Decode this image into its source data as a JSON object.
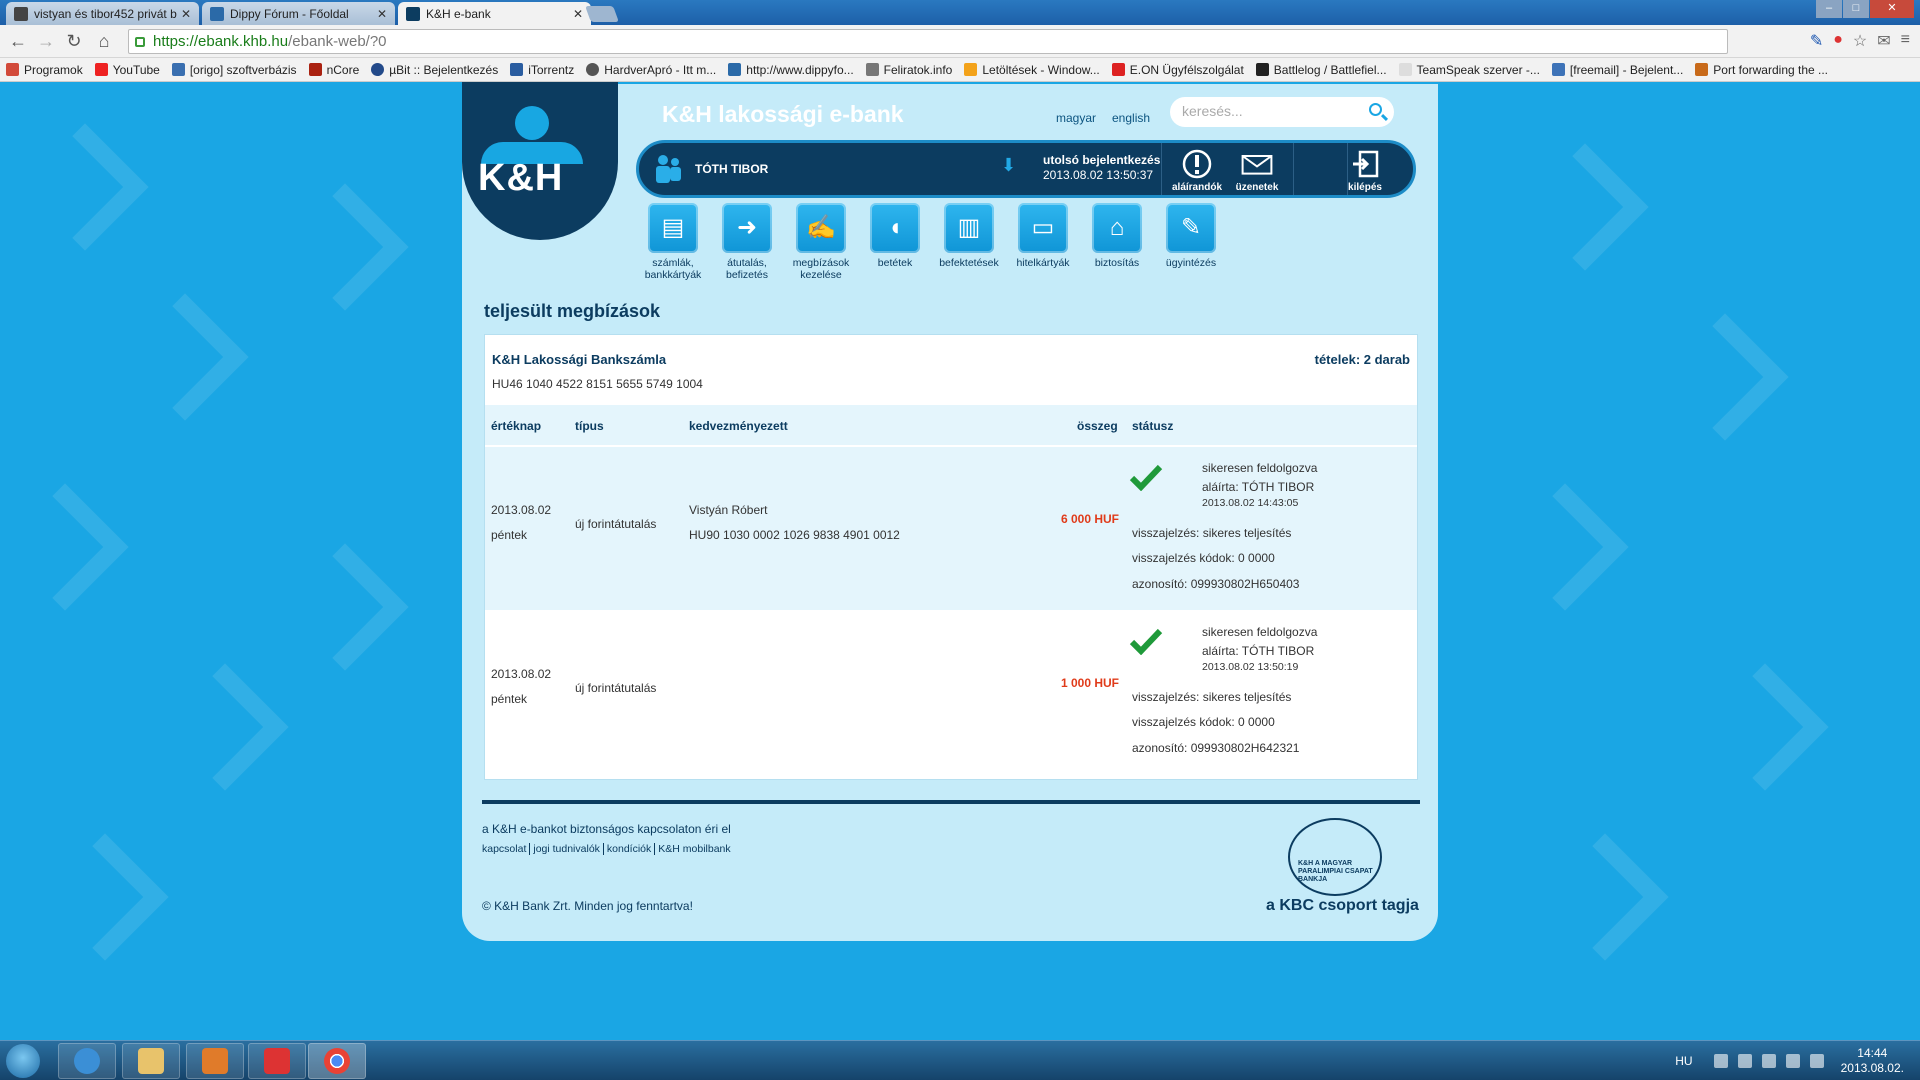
{
  "browser": {
    "tabs": [
      {
        "title": "vistyan és tibor452 privát b",
        "active": false
      },
      {
        "title": "Dippy Fórum - Főoldal",
        "active": false
      },
      {
        "title": "K&H e-bank",
        "active": true
      }
    ],
    "url_host": "https://ebank.khb.hu",
    "url_path": "/ebank-web/?0",
    "bookmarks": [
      "Programok",
      "YouTube",
      "[origo] szoftverbázis",
      "nCore",
      "µBit :: Bejelentkezés",
      "iTorrentz",
      "HardverApró - Itt m...",
      "http://www.dippyfo...",
      "Feliratok.info",
      "Letöltések - Window...",
      "E.ON Ügyfélszolgálat",
      "Battlelog / Battlefiel...",
      "TeamSpeak szerver -...",
      "[freemail] - Bejelent...",
      "Port forwarding the ..."
    ]
  },
  "header": {
    "logo": "K&H",
    "title": "K&H lakossági e-bank",
    "lang_hu": "magyar",
    "lang_en": "english",
    "search_placeholder": "keresés..."
  },
  "userbar": {
    "user_name": "TÓTH TIBOR",
    "last_login_label": "utolsó bejelentkezés",
    "last_login_value": "2013.08.02 13:50:37",
    "signatories": "aláírandók",
    "messages": "üzenetek",
    "logout": "kilépés"
  },
  "menu": [
    {
      "line1": "számlák,",
      "line2": "bankkártyák",
      "icon": "card-icon"
    },
    {
      "line1": "átutalás,",
      "line2": "befizetés",
      "icon": "transfer-icon"
    },
    {
      "line1": "megbízások",
      "line2": "kezelése",
      "icon": "orders-icon"
    },
    {
      "line1": "betétek",
      "line2": "",
      "icon": "piggy-icon"
    },
    {
      "line1": "befektetések",
      "line2": "",
      "icon": "chart-icon"
    },
    {
      "line1": "hitelkártyák",
      "line2": "",
      "icon": "creditcard-icon"
    },
    {
      "line1": "biztosítás",
      "line2": "",
      "icon": "insurance-icon"
    },
    {
      "line1": "ügyintézés",
      "line2": "",
      "icon": "pen-icon"
    }
  ],
  "main": {
    "section_title": "teljesült megbízások",
    "account_name": "K&H Lakossági Bankszámla",
    "account_number": "HU46 1040 4522 8151 5655 5749 1004",
    "item_count": "tételek: 2 darab",
    "columns": {
      "date": "értéknap",
      "type": "típus",
      "beneficiary": "kedvezményezett",
      "amount": "összeg",
      "status": "státusz"
    },
    "rows": [
      {
        "date": "2013.08.02",
        "day": "péntek",
        "type": "új forintátutalás",
        "beneficiary": "Vistyán Róbert",
        "beneficiary_account": "HU90 1030 0002 1026 9838 4901 0012",
        "amount": "6 000 HUF",
        "status": "sikeresen feldolgozva",
        "signed": "aláírta: TÓTH TIBOR",
        "signed_at": "2013.08.02 14:43:05",
        "feedback": "visszajelzés: sikeres teljesítés",
        "feedback_code": "visszajelzés kódok: 0 0000",
        "identifier": "azonosító: 099930802H650403"
      },
      {
        "date": "2013.08.02",
        "day": "péntek",
        "type": "új forintátutalás",
        "beneficiary": "",
        "beneficiary_account": "",
        "amount": "1 000 HUF",
        "status": "sikeresen feldolgozva",
        "signed": "aláírta: TÓTH TIBOR",
        "signed_at": "2013.08.02 13:50:19",
        "feedback": "visszajelzés: sikeres teljesítés",
        "feedback_code": "visszajelzés kódok: 0 0000",
        "identifier": "azonosító: 099930802H642321"
      }
    ]
  },
  "footer": {
    "secure": "a K&H e-bankot biztonságos kapcsolaton éri el",
    "links": [
      "kapcsolat",
      "jogi tudnivalók",
      "kondíciók",
      "K&H mobilbank"
    ],
    "copyright": "© K&H Bank Zrt. Minden jog fenntartva!",
    "kbc": "a KBC csoport tagja",
    "emblem": "K&H A MAGYAR PARALIMPIAI CSAPAT BANKJA"
  },
  "taskbar": {
    "lang": "HU",
    "time": "14:44",
    "date": "2013.08.02."
  },
  "colors": {
    "page_bg": "#1aa6e4",
    "navy": "#0c3c60",
    "amount_red": "#e03b1a",
    "check_green": "#1f9a3a"
  }
}
